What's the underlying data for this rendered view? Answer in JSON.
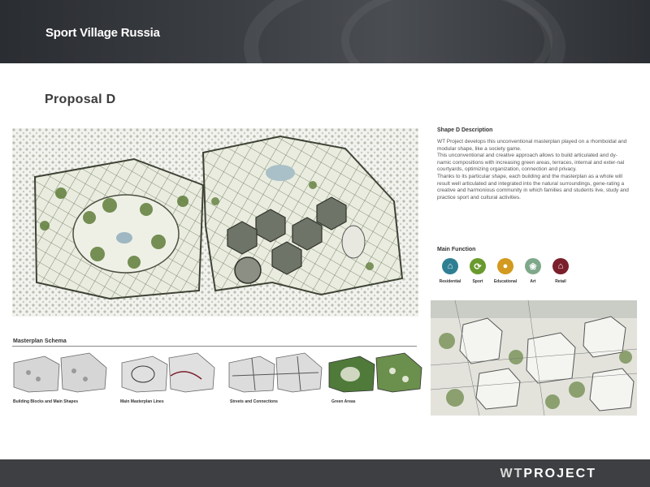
{
  "header": {
    "title": "Sport Village Russia"
  },
  "page_title": "Proposal D",
  "description": {
    "title": "Shape D Description",
    "paragraphs": [
      "WT Project develops this unconventional masterplan played on a rhomboidal and modular shape, like a society game.",
      "This unconventional and creative approach allows to build articulated and dy-namic compositions with increasing green areas, terraces, internal and exter-nal courtyards, optimizing organization, connection and privacy.",
      "Thanks to its particular shape, each building and the masterplan as a whole will result well articulated and integrated into the natural surroundings, gene-rating a creative and harmonious community in which families and students live, study and practice sport and cultural activities."
    ]
  },
  "main_function": {
    "title": "Main Function",
    "items": [
      {
        "label": "Residential",
        "icon": "house-icon",
        "color": "#2f7f93"
      },
      {
        "label": "Sport",
        "icon": "sport-icon",
        "color": "#6a9a2e"
      },
      {
        "label": "Educational",
        "icon": "education-icon",
        "color": "#d29a1e"
      },
      {
        "label": "Art",
        "icon": "art-icon",
        "color": "#7fa88a"
      },
      {
        "label": "Retail",
        "icon": "retail-icon",
        "color": "#7a1f2b"
      }
    ]
  },
  "schema": {
    "title": "Masterplan Schema",
    "items": [
      {
        "label": "Building Blocks and Main Shapes"
      },
      {
        "label": "Main Masterplan Lines"
      },
      {
        "label": "Streets and Connections"
      },
      {
        "label": "Green Areas"
      }
    ]
  },
  "footer": {
    "logo_wt": "WT",
    "logo_project": "PROJECT"
  },
  "colors": {
    "header_bg": "#3b3e43",
    "footer_bg": "#3d3f42",
    "green_accent": "#5f7d3a"
  }
}
